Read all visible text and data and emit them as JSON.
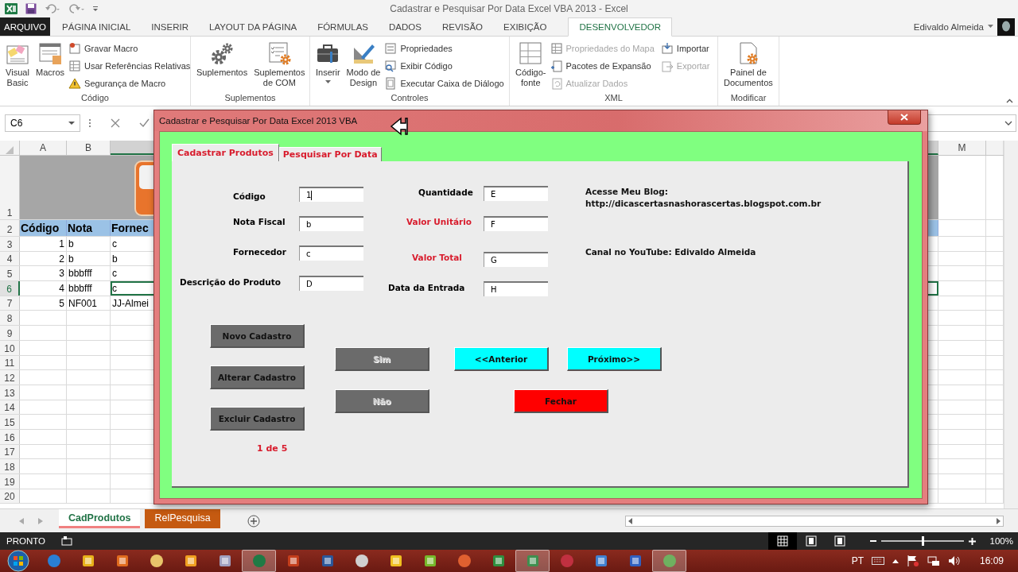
{
  "title_bar": {
    "title": "Cadastrar e Pesquisar Por Data Excel VBA 2013 - Excel"
  },
  "ribbon_tabs": [
    {
      "label": "ARQUIVO",
      "kind": "file",
      "selected": false
    },
    {
      "label": "PÁGINA INICIAL",
      "kind": "tab",
      "selected": false
    },
    {
      "label": "INSERIR",
      "kind": "tab",
      "selected": false
    },
    {
      "label": "LAYOUT DA PÁGINA",
      "kind": "tab",
      "selected": false
    },
    {
      "label": "FÓRMULAS",
      "kind": "tab",
      "selected": false
    },
    {
      "label": "DADOS",
      "kind": "tab",
      "selected": false
    },
    {
      "label": "REVISÃO",
      "kind": "tab",
      "selected": false
    },
    {
      "label": "EXIBIÇÃO",
      "kind": "tab",
      "selected": false
    },
    {
      "label": "DESENVOLVEDOR",
      "kind": "tab",
      "selected": true
    }
  ],
  "account": {
    "name": "Edivaldo Almeida"
  },
  "ribbon_groups": [
    {
      "label": "Código",
      "items": [
        {
          "kind": "large",
          "lines": [
            "Visual",
            "Basic"
          ],
          "disabled": false
        },
        {
          "kind": "large",
          "lines": [
            "Macros"
          ],
          "disabled": false
        },
        {
          "kind": "small",
          "lines": [
            "Gravar Macro"
          ],
          "disabled": false
        },
        {
          "kind": "small",
          "lines": [
            "Usar Referências Relativas"
          ],
          "disabled": false
        },
        {
          "kind": "small",
          "lines": [
            "Segurança de Macro"
          ],
          "disabled": false
        }
      ]
    },
    {
      "label": "Suplementos",
      "items": [
        {
          "kind": "large",
          "lines": [
            "Suplementos"
          ],
          "disabled": false
        },
        {
          "kind": "large",
          "lines": [
            "Suplementos",
            "de COM"
          ],
          "disabled": false
        }
      ]
    },
    {
      "label": "Controles",
      "items": [
        {
          "kind": "large",
          "lines": [
            "Inserir"
          ],
          "dropdown": true,
          "disabled": false
        },
        {
          "kind": "large",
          "lines": [
            "Modo de",
            "Design"
          ],
          "disabled": false
        },
        {
          "kind": "small",
          "lines": [
            "Propriedades"
          ],
          "disabled": false
        },
        {
          "kind": "small",
          "lines": [
            "Exibir Código"
          ],
          "disabled": false
        },
        {
          "kind": "small",
          "lines": [
            "Executar Caixa de Diálogo"
          ],
          "disabled": false
        }
      ]
    },
    {
      "label": "XML",
      "items": [
        {
          "kind": "large",
          "lines": [
            "Código-",
            "fonte"
          ],
          "disabled": false
        },
        {
          "kind": "small",
          "lines": [
            "Propriedades do Mapa"
          ],
          "disabled": true
        },
        {
          "kind": "small",
          "lines": [
            "Pacotes de Expansão"
          ],
          "disabled": false
        },
        {
          "kind": "small",
          "lines": [
            "Atualizar Dados"
          ],
          "disabled": true
        },
        {
          "kind": "small",
          "lines": [
            "Importar"
          ],
          "disabled": false
        },
        {
          "kind": "small",
          "lines": [
            "Exportar"
          ],
          "disabled": true
        }
      ]
    },
    {
      "label": "Modificar",
      "items": [
        {
          "kind": "large",
          "lines": [
            "Painel de",
            "Documentos"
          ],
          "disabled": false
        }
      ]
    }
  ],
  "formula_bar": {
    "name_box": "C6"
  },
  "sheet": {
    "columns": [
      {
        "label": "A",
        "selected": false
      },
      {
        "label": "B",
        "selected": false
      },
      {
        "selected": true
      },
      {
        "label": "M",
        "selected": false
      }
    ],
    "rows": [
      {
        "label": "1",
        "kind": "banner",
        "selected": false
      },
      {
        "label": "2",
        "kind": "header",
        "selected": false,
        "cells": [
          "Código",
          "Nota",
          "Fornec"
        ]
      },
      {
        "label": "3",
        "kind": "data",
        "selected": false,
        "cells": [
          "1",
          "b",
          "c"
        ]
      },
      {
        "label": "4",
        "kind": "data",
        "selected": false,
        "cells": [
          "2",
          "b",
          "b"
        ]
      },
      {
        "label": "5",
        "kind": "data",
        "selected": false,
        "cells": [
          "3",
          "bbbfff",
          "c"
        ]
      },
      {
        "label": "6",
        "kind": "data",
        "selected": true,
        "cells": [
          "4",
          "bbbfff",
          "c"
        ]
      },
      {
        "label": "7",
        "kind": "data",
        "selected": false,
        "cells": [
          "5",
          "NF001",
          "JJ-Almei"
        ]
      },
      {
        "label": "8",
        "kind": "data",
        "selected": false
      },
      {
        "label": "9",
        "kind": "data",
        "selected": false
      },
      {
        "label": "10",
        "kind": "data",
        "selected": false
      },
      {
        "label": "11",
        "kind": "data",
        "selected": false
      },
      {
        "label": "12",
        "kind": "data",
        "selected": false
      },
      {
        "label": "13",
        "kind": "data",
        "selected": false
      },
      {
        "label": "14",
        "kind": "data",
        "selected": false
      },
      {
        "label": "15",
        "kind": "data",
        "selected": false
      },
      {
        "label": "16",
        "kind": "data",
        "selected": false
      },
      {
        "label": "17",
        "kind": "data",
        "selected": false
      },
      {
        "label": "18",
        "kind": "data",
        "selected": false
      },
      {
        "label": "19",
        "kind": "data",
        "selected": false
      },
      {
        "label": "20",
        "kind": "data",
        "selected": false
      }
    ],
    "tabs": [
      {
        "label": "CadProdutos",
        "selected": true,
        "color": "#f08080"
      },
      {
        "label": "RelPesquisa",
        "selected": false,
        "color": "#c55a11"
      }
    ]
  },
  "status_bar": {
    "text": "PRONTO",
    "views": [
      {
        "selected": true
      },
      {
        "selected": false
      },
      {
        "selected": false
      }
    ],
    "zoom": {
      "level": 0.5,
      "reading": "100%"
    }
  },
  "taskbar": {
    "apps": [
      {
        "selected": false
      },
      {
        "selected": false
      },
      {
        "selected": false
      },
      {
        "selected": false
      },
      {
        "selected": false
      },
      {
        "selected": false
      },
      {
        "selected": true
      },
      {
        "selected": false
      },
      {
        "selected": false
      },
      {
        "selected": false
      },
      {
        "selected": false
      },
      {
        "selected": false
      },
      {
        "selected": false
      },
      {
        "selected": false
      },
      {
        "selected": true
      },
      {
        "selected": false
      },
      {
        "selected": false
      },
      {
        "selected": false
      },
      {
        "selected": true
      }
    ],
    "language": "PT",
    "clock": "16:09"
  },
  "dialog": {
    "title": "Cadastrar e Pesquisar Por Data Excel 2013 VBA",
    "tabs": [
      {
        "label": "Cadastrar Produtos",
        "selected": true
      },
      {
        "label": "Pesquisar Por Data",
        "selected": false
      }
    ],
    "fields": [
      {
        "label": "Código",
        "value": "1",
        "color": "#000000",
        "focused": true
      },
      {
        "label": "Nota Fiscal",
        "value": "b",
        "color": "#000000",
        "focused": false
      },
      {
        "label": "Fornecedor",
        "value": "c",
        "color": "#000000",
        "focused": false
      },
      {
        "label": "Descrição do Produto",
        "value": "D",
        "color": "#000000",
        "focused": false
      },
      {
        "label": "Quantidade",
        "value": "E",
        "color": "#000000",
        "focused": false
      },
      {
        "label": "Valor Unitário",
        "value": "F",
        "color": "#d81b2c",
        "focused": false
      },
      {
        "label": "Valor Total",
        "value": "G",
        "color": "#d81b2c",
        "focused": false
      },
      {
        "label": "Data da Entrada",
        "value": "H",
        "color": "#000000",
        "focused": false
      }
    ],
    "info_lines": [
      "Acesse Meu Blog:",
      "http://dicascertasnashorascertas.blogspot.com.br",
      "Canal no YouTube: Edivaldo Almeida"
    ],
    "buttons": [
      {
        "label": "Novo Cadastro",
        "color": "#6b6b6b",
        "disabled": false
      },
      {
        "label": "Alterar Cadastro",
        "color": "#6b6b6b",
        "disabled": false
      },
      {
        "label": "Excluir Cadastro",
        "color": "#6b6b6b",
        "disabled": false
      },
      {
        "label": "Sim",
        "color": "#6b6b6b",
        "disabled": true
      },
      {
        "label": "Não",
        "color": "#6b6b6b",
        "disabled": true
      },
      {
        "label": "<<Anterior",
        "color": "#00ffff",
        "disabled": false
      },
      {
        "label": "Próximo>>",
        "color": "#00ffff",
        "disabled": false
      },
      {
        "label": "Fechar",
        "color": "#ff0000",
        "disabled": false
      }
    ],
    "record_counter": "1 de 5"
  }
}
